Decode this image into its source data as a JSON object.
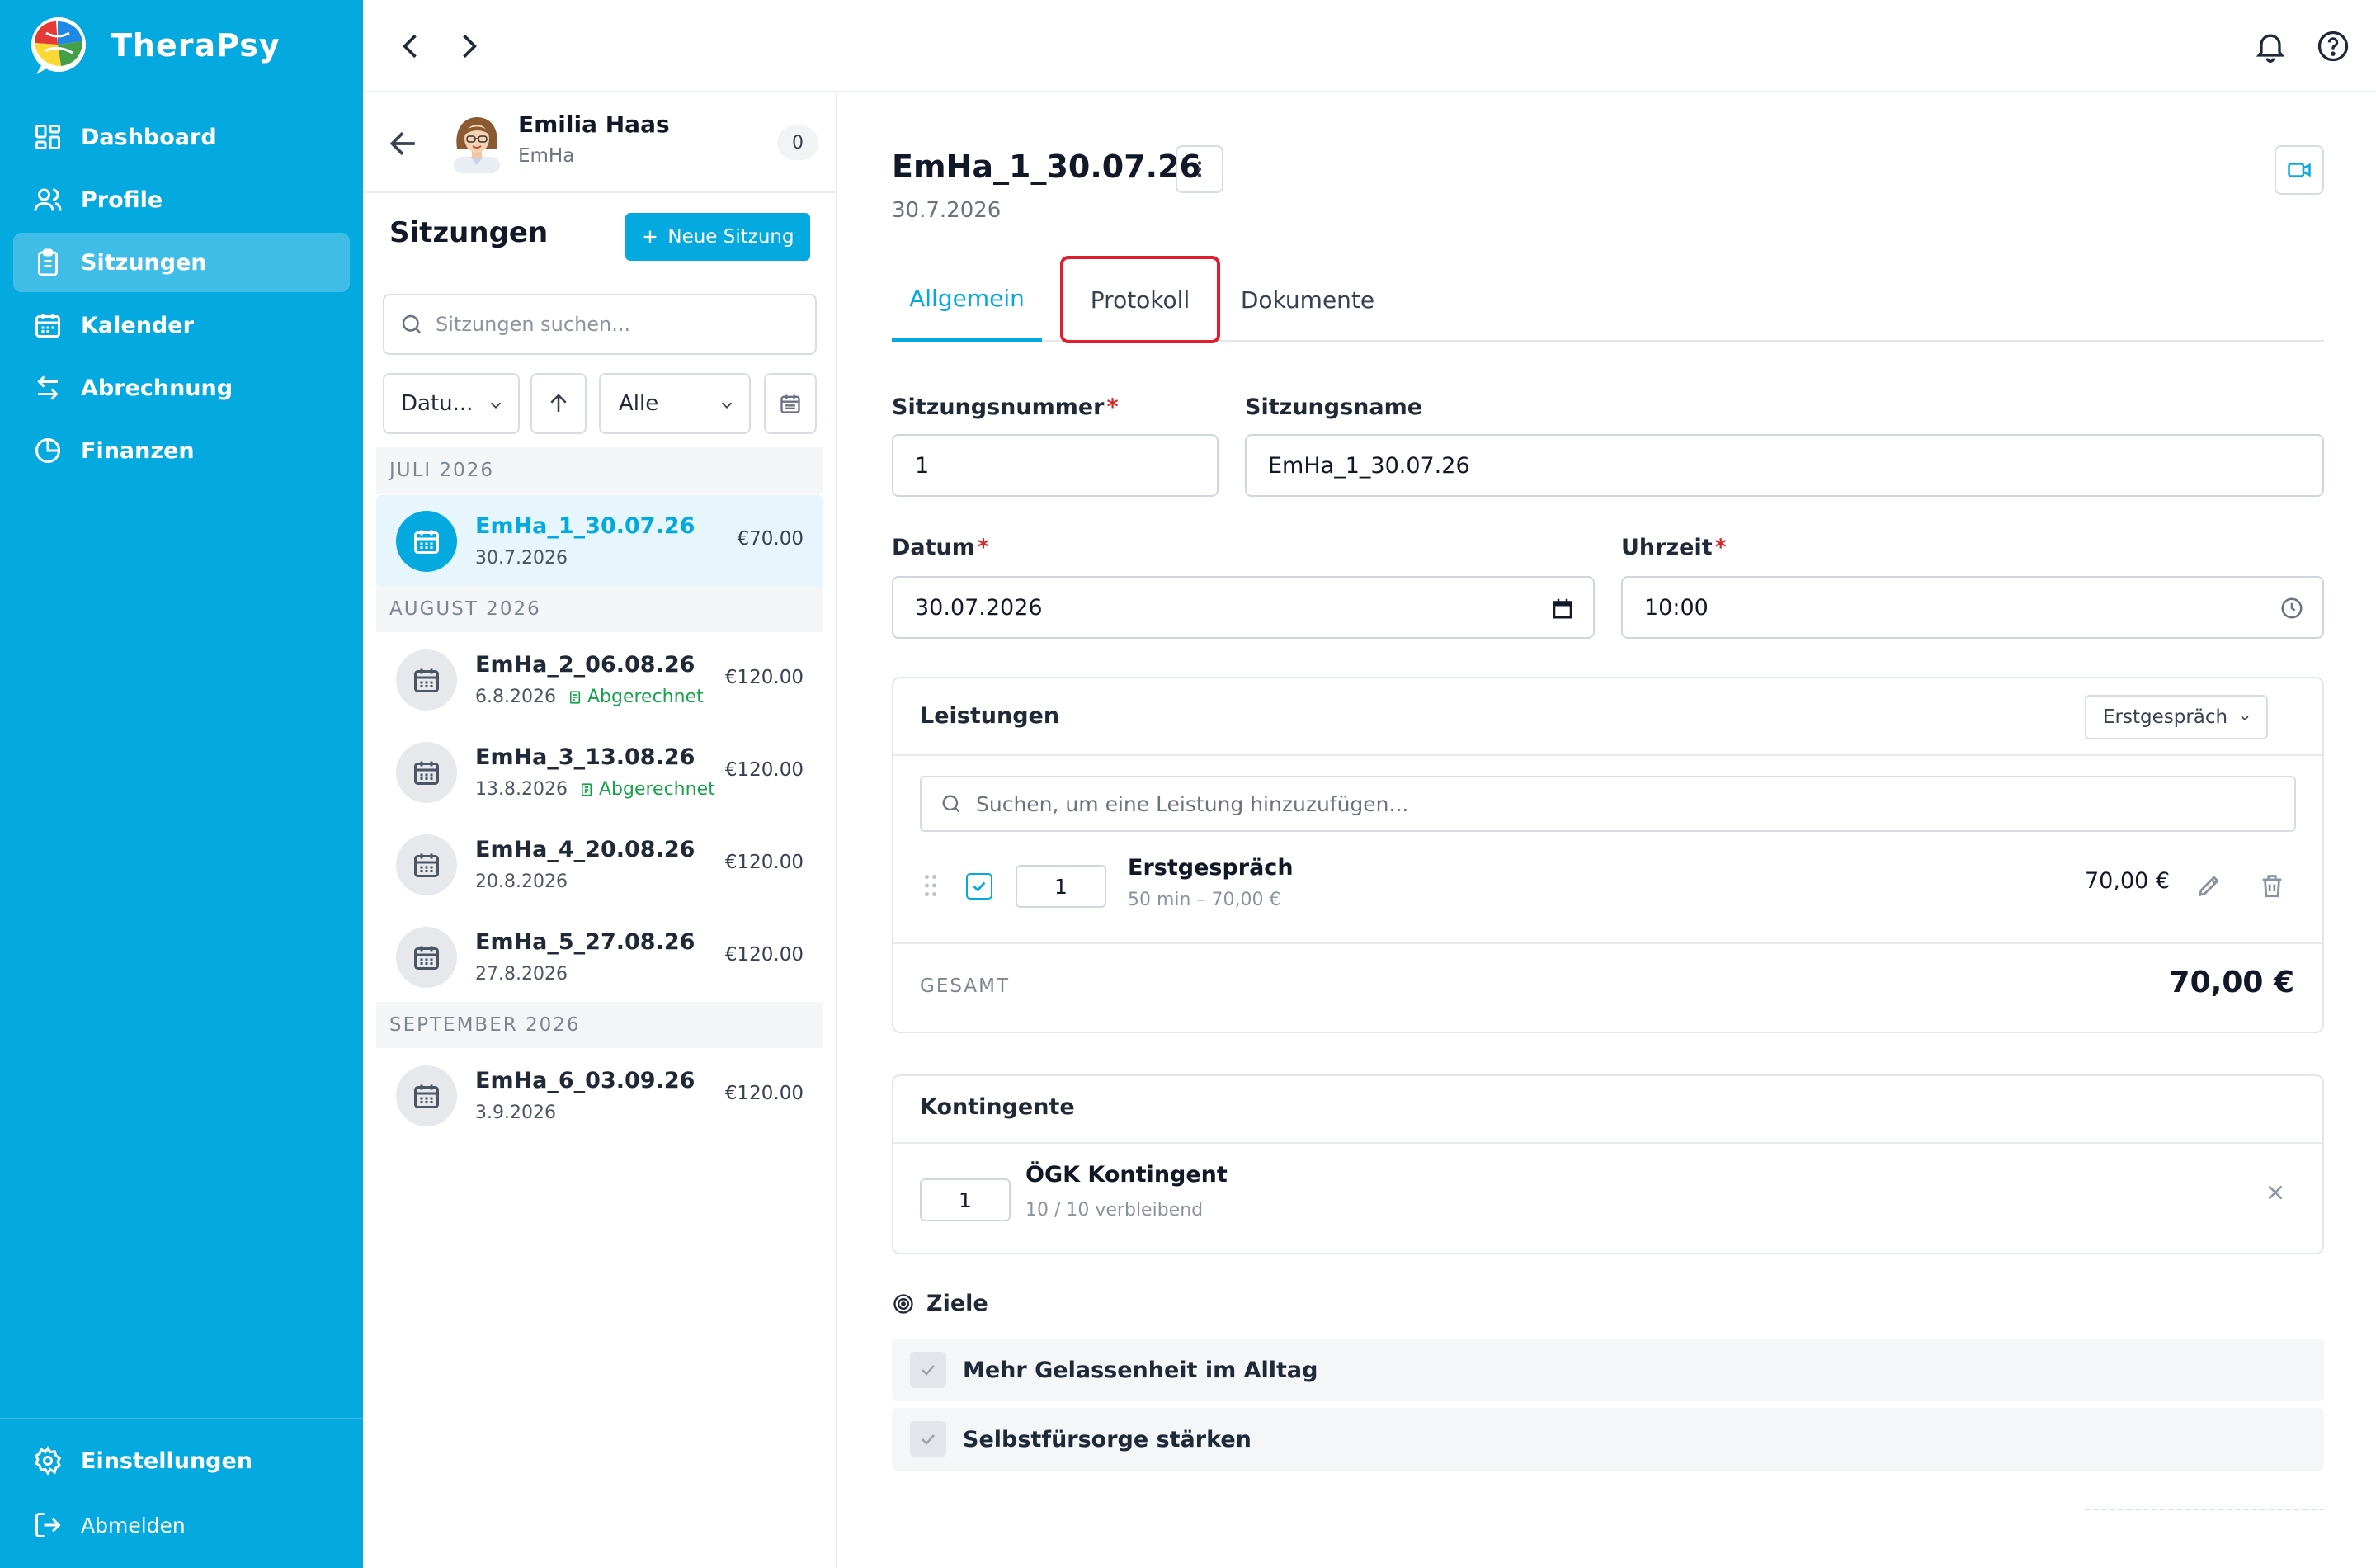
{
  "app": {
    "name": "TheraPsy"
  },
  "sidebar": {
    "items": [
      {
        "label": "Dashboard",
        "icon": "dashboard-icon"
      },
      {
        "label": "Profile",
        "icon": "users-icon"
      },
      {
        "label": "Sitzungen",
        "icon": "clipboard-icon",
        "active": true
      },
      {
        "label": "Kalender",
        "icon": "calendar-icon"
      },
      {
        "label": "Abrechnung",
        "icon": "arrows-icon"
      },
      {
        "label": "Finanzen",
        "icon": "pie-chart-icon"
      }
    ],
    "settings_label": "Einstellungen",
    "logout_label": "Abmelden"
  },
  "client": {
    "name": "Emilia Haas",
    "short": "EmHa",
    "count": "0"
  },
  "list": {
    "title": "Sitzungen",
    "new_button": "Neue Sitzung",
    "search_placeholder": "Sitzungen suchen...",
    "sort_label": "Datu...",
    "status_label": "Alle",
    "groups": [
      {
        "month": "JULI 2026"
      },
      {
        "month": "AUGUST 2026"
      },
      {
        "month": "SEPTEMBER 2026"
      }
    ],
    "sessions": [
      {
        "name": "EmHa_1_30.07.26",
        "date": "30.7.2026",
        "price": "€70.00",
        "billed": ""
      },
      {
        "name": "EmHa_2_06.08.26",
        "date": "6.8.2026",
        "price": "€120.00",
        "billed": "Abgerechnet"
      },
      {
        "name": "EmHa_3_13.08.26",
        "date": "13.8.2026",
        "price": "€120.00",
        "billed": "Abgerechnet"
      },
      {
        "name": "EmHa_4_20.08.26",
        "date": "20.8.2026",
        "price": "€120.00",
        "billed": ""
      },
      {
        "name": "EmHa_5_27.08.26",
        "date": "27.8.2026",
        "price": "€120.00",
        "billed": ""
      },
      {
        "name": "EmHa_6_03.09.26",
        "date": "3.9.2026",
        "price": "€120.00",
        "billed": ""
      }
    ]
  },
  "detail": {
    "title": "EmHa_1_30.07.26",
    "date": "30.7.2026",
    "tabs": [
      "Allgemein",
      "Protokoll",
      "Dokumente"
    ],
    "fields": {
      "number_label": "Sitzungsnummer",
      "number_value": "1",
      "name_label": "Sitzungsname",
      "name_value": "EmHa_1_30.07.26",
      "date_label": "Datum",
      "date_value": "30.07.2026",
      "time_label": "Uhrzeit",
      "time_value": "10:00"
    },
    "services": {
      "title": "Leistungen",
      "preset": "Erstgespräch",
      "search_placeholder": "Suchen, um eine Leistung hinzuzufügen...",
      "item": {
        "qty": "1",
        "name": "Erstgespräch",
        "sub": "50 min – 70,00 €",
        "price": "70,00 €"
      },
      "total_label": "GESAMT",
      "total_value": "70,00 €"
    },
    "quota": {
      "title": "Kontingente",
      "qty": "1",
      "name": "ÖGK Kontingent",
      "sub": "10 / 10 verbleibend"
    },
    "goals": {
      "title": "Ziele",
      "items": [
        "Mehr Gelassenheit im Alltag",
        "Selbstfürsorge stärken"
      ]
    }
  },
  "colors": {
    "accent": "#04a9df",
    "highlight": "#e11d2e",
    "billed": "#16a34a"
  }
}
